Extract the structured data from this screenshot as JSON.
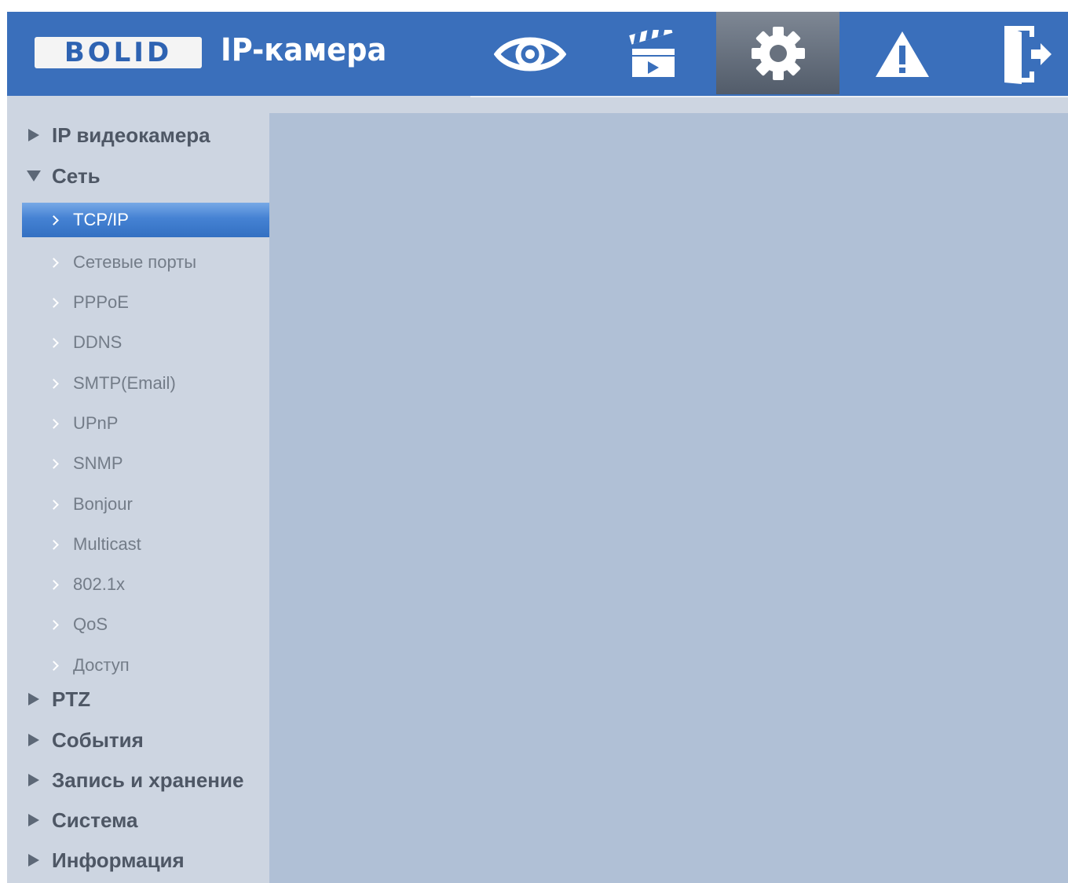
{
  "header": {
    "logo_text": "BOLID",
    "app_title": "IP-камера",
    "nav": [
      {
        "icon": "eye-icon",
        "name": "live-view"
      },
      {
        "icon": "clapperboard-icon",
        "name": "playback"
      },
      {
        "icon": "gear-icon",
        "name": "settings",
        "active": true
      },
      {
        "icon": "warning-icon",
        "name": "alarm"
      },
      {
        "icon": "exit-icon",
        "name": "logout"
      }
    ]
  },
  "sidebar": {
    "sections": [
      {
        "label": "IP видеокамера",
        "expanded": false
      },
      {
        "label": "Сеть",
        "expanded": true
      },
      {
        "label": "PTZ",
        "expanded": false
      },
      {
        "label": "События",
        "expanded": false
      },
      {
        "label": "Запись и хранение",
        "expanded": false
      },
      {
        "label": "Система",
        "expanded": false
      },
      {
        "label": "Информация",
        "expanded": false
      }
    ],
    "network_items": [
      {
        "label": "TCP/IP",
        "active": true
      },
      {
        "label": "Сетевые порты"
      },
      {
        "label": "PPPoE"
      },
      {
        "label": "DDNS"
      },
      {
        "label": "SMTP(Email)"
      },
      {
        "label": "UPnP"
      },
      {
        "label": "SNMP"
      },
      {
        "label": "Bonjour"
      },
      {
        "label": "Multicast"
      },
      {
        "label": "802.1x"
      },
      {
        "label": "QoS"
      },
      {
        "label": "Доступ"
      }
    ]
  },
  "colors": {
    "header_bg": "#3a6fbb",
    "sidebar_bg": "#cdd5e1",
    "content_bg": "#b0c0d6",
    "active_item": "#3f7ccd"
  }
}
